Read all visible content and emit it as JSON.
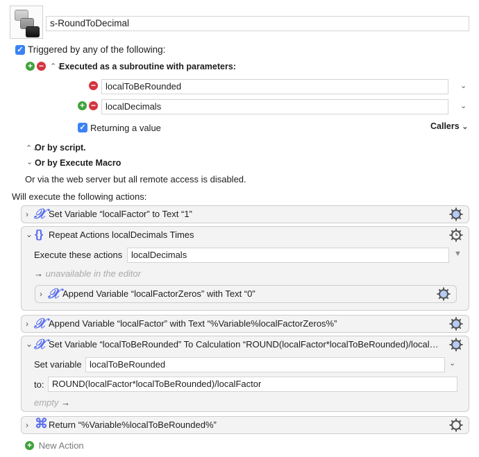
{
  "macro": {
    "icon": "macro-keys-icon",
    "name": "s-RoundToDecimal"
  },
  "triggers": {
    "triggered_label": "Triggered by any of the following:",
    "triggered_checked": true,
    "subroutine_label": "Executed as a subroutine with parameters:",
    "parameters": [
      {
        "value": "localToBeRounded"
      },
      {
        "value": "localDecimals"
      }
    ],
    "returning_label": "Returning a value",
    "returning_checked": true,
    "callers_label": "Callers",
    "by_script_label": "Or by script.",
    "by_execute_macro_label": "Or by Execute Macro",
    "web_server_label": "Or via the web server but all remote access is disabled."
  },
  "actions_header": "Will execute the following actions:",
  "actions": [
    {
      "icon": "variable-icon",
      "title": "Set Variable “localFactor” to Text “1”",
      "gear": "gear-icon"
    },
    {
      "icon": "repeat-icon",
      "title": "Repeat Actions localDecimals Times",
      "gear": "gear-clock-icon",
      "execute_label": "Execute these actions",
      "execute_value": "localDecimals",
      "unavailable_text": "unavailable in the editor",
      "nested": {
        "icon": "variable-icon",
        "title": "Append Variable “localFactorZeros” with Text “0”",
        "gear": "gear-icon"
      }
    },
    {
      "icon": "variable-icon",
      "title": "Append Variable “localFactor” with Text “%Variable%localFactorZeros%”",
      "gear": "gear-icon"
    },
    {
      "icon": "variable-icon",
      "title": "Set Variable “localToBeRounded” To Calculation “ROUND(localFactor*localToBeRounded)/local…",
      "gear": "gear-icon",
      "set_variable_label": "Set variable",
      "set_variable_value": "localToBeRounded",
      "to_label": "to:",
      "to_value": "ROUND(localFactor*localToBeRounded)/localFactor",
      "empty_text": "empty"
    },
    {
      "icon": "return-icon",
      "title": "Return “%Variable%localToBeRounded%”",
      "gear": "gear-plain-icon"
    }
  ],
  "new_action_label": "New Action",
  "colors": {
    "accent": "#5a6ff0",
    "checkbox": "#3b82f6",
    "add_green": "#3fa23a",
    "remove_red": "#d4343f"
  }
}
